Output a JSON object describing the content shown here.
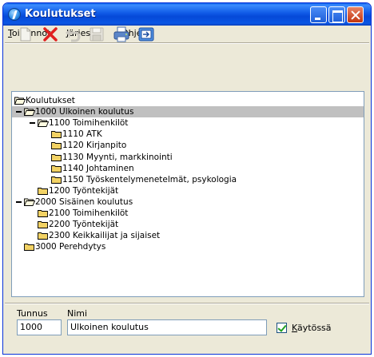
{
  "window": {
    "title": "Koulutukset"
  },
  "menu": {
    "items": [
      "Toiminnot",
      "Järjestys",
      "Ohje"
    ],
    "mnemonics": [
      "T",
      "J",
      "O"
    ]
  },
  "toolbar": {
    "buttons": [
      {
        "icon": "new-document-icon",
        "enabled": false
      },
      {
        "icon": "delete-x-icon",
        "enabled": true
      },
      {
        "icon": "undo-arrow-icon",
        "enabled": false
      },
      {
        "icon": "save-floppy-icon",
        "enabled": false
      },
      {
        "icon": "print-icon",
        "enabled": true
      },
      {
        "icon": "export-icon",
        "enabled": true
      }
    ]
  },
  "tree": {
    "root": "Koulutukset",
    "nodes": [
      {
        "label": "1000 Ulkoinen koulutus",
        "level": 1,
        "expanded": true,
        "selected": true
      },
      {
        "label": "1100 Toimihenkilöt",
        "level": 2,
        "expanded": true
      },
      {
        "label": "1110 ATK",
        "level": 3
      },
      {
        "label": "1120 Kirjanpito",
        "level": 3
      },
      {
        "label": "1130 Myynti, markkinointi",
        "level": 3
      },
      {
        "label": "1140 Johtaminen",
        "level": 3
      },
      {
        "label": "1150 Työskentelymenetelmät, psykologia",
        "level": 3
      },
      {
        "label": "1200 Työntekijät",
        "level": 2
      },
      {
        "label": "2000 Sisäinen koulutus",
        "level": 1,
        "expanded": true
      },
      {
        "label": "2100 Toimihenkilöt",
        "level": 2
      },
      {
        "label": "2200 Työntekijät",
        "level": 2
      },
      {
        "label": "2300 Keikkailijat ja sijaiset",
        "level": 2
      },
      {
        "label": "3000 Perehdytys",
        "level": 1
      }
    ]
  },
  "form": {
    "tunnus_label": "Tunnus",
    "nimi_label": "Nimi",
    "tunnus_value": "1000",
    "nimi_value": "Ulkoinen koulutus",
    "active_label": "Käytössä",
    "active_checked": true
  },
  "colors": {
    "title_bar": "#0a56e4",
    "window_bg": "#ece9d8",
    "selection": "#c0c0c0",
    "folder": "#f2d264",
    "delete_red": "#e02020"
  }
}
